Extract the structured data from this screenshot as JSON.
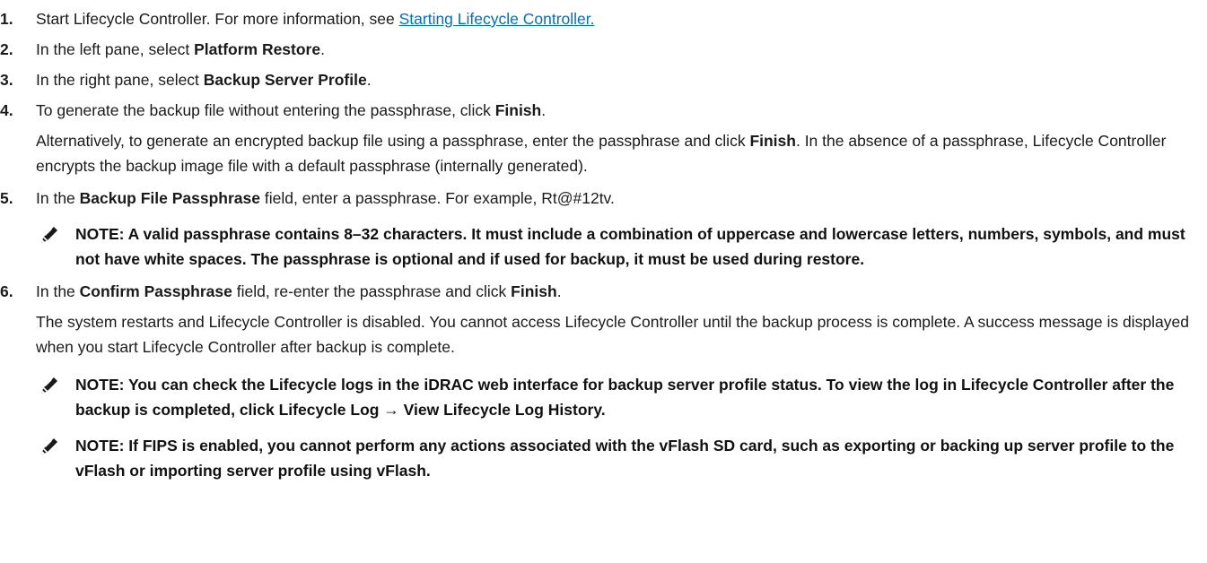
{
  "steps": [
    {
      "num": "1.",
      "text": "Start Lifecycle Controller. For more information, see ",
      "link": "Starting Lifecycle Controller."
    },
    {
      "num": "2.",
      "pre": "In the left pane, select ",
      "bold": "Platform Restore",
      "post": "."
    },
    {
      "num": "3.",
      "pre": "In the right pane, select ",
      "bold": "Backup Server Profile",
      "post": "."
    },
    {
      "num": "4.",
      "pre": "To generate the backup file without entering the passphrase, click ",
      "bold": "Finish",
      "post": ".",
      "para_pre": "Alternatively, to generate an encrypted backup file using a passphrase, enter the passphrase and click ",
      "para_bold": "Finish",
      "para_post": ". In the absence of a passphrase, Lifecycle Controller encrypts the backup image file with a default passphrase (internally generated)."
    },
    {
      "num": "5.",
      "pre": "In the ",
      "bold": "Backup File Passphrase",
      "mid": " field, enter a passphrase. For example, ",
      "example": "Rt@#12tv",
      "post": "."
    },
    {
      "num": "6.",
      "pre": "In the ",
      "bold": "Confirm Passphrase",
      "mid": " field, re-enter the passphrase and click ",
      "bold2": "Finish",
      "post": ".",
      "para": "The system restarts and Lifecycle Controller is disabled. You cannot access Lifecycle Controller until the backup process is complete. A success message is displayed when you start Lifecycle Controller after backup is complete."
    }
  ],
  "notes": {
    "passphrase": "NOTE: A valid passphrase contains 8–32 characters. It must include a combination of uppercase and lowercase letters, numbers, symbols, and must not have white spaces. The passphrase is optional and if used for backup, it must be used during restore.",
    "lifecycle_logs": "NOTE: You can check the Lifecycle logs in the iDRAC web interface for backup server profile status. To view the log in Lifecycle Controller after the backup is completed, click Lifecycle Log → View Lifecycle Log History.",
    "fips": "NOTE: If FIPS is enabled, you cannot perform any actions associated with the vFlash SD card, such as exporting or backing up server profile to the vFlash or importing server profile using vFlash."
  },
  "icons": {
    "note": "note-pencil-icon"
  }
}
